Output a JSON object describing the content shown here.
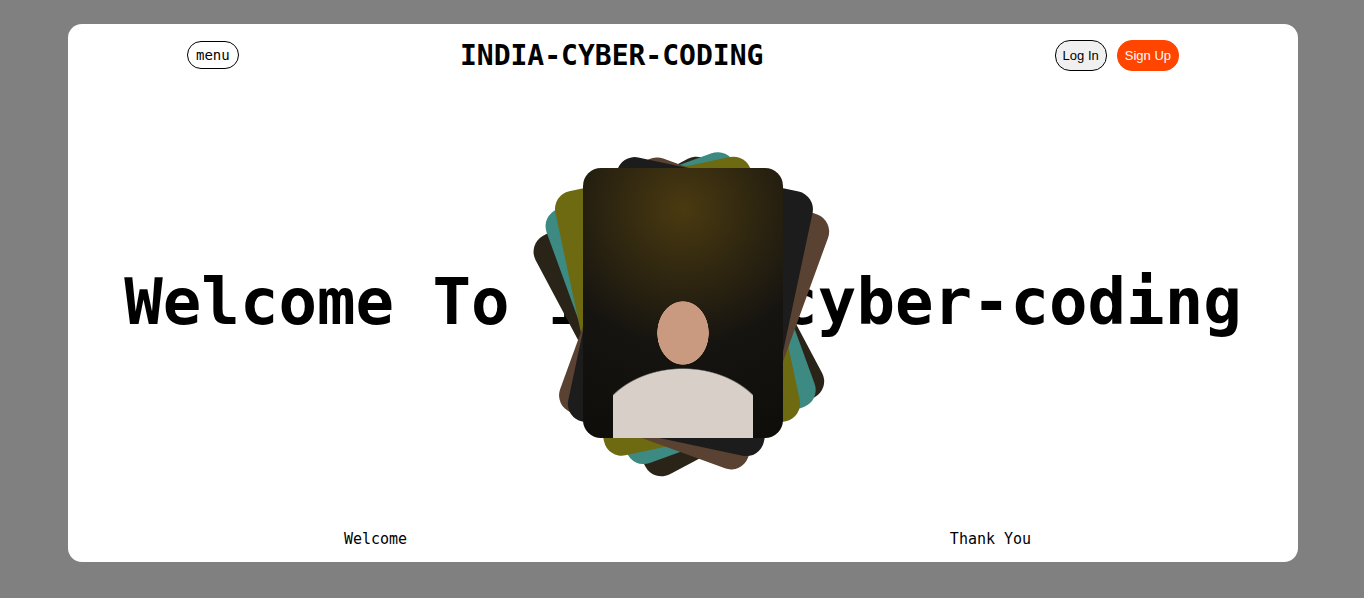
{
  "header": {
    "menu": "menu",
    "title": "INDIA-CYBER-CODING",
    "buttons": [
      {
        "label": "Log In",
        "kind": "outline"
      },
      {
        "label": "Sign Up",
        "kind": "filled"
      }
    ]
  },
  "hero": {
    "heading": "Welcome To india-cyber-coding"
  },
  "footer": {
    "items": [
      "Welcome",
      "Thank You"
    ]
  }
}
